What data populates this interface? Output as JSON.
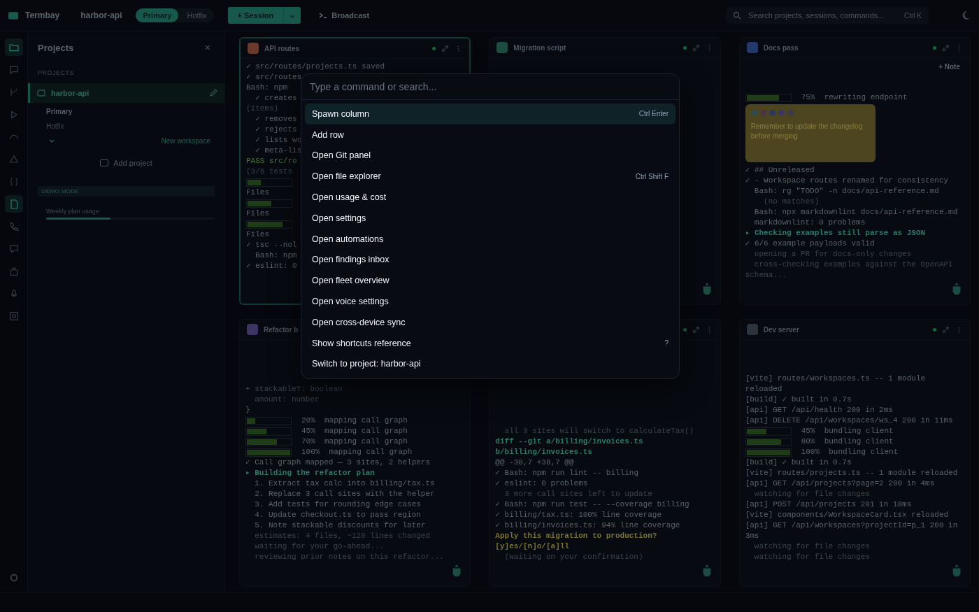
{
  "topbar": {
    "app_name": "Termbay",
    "project": "harbor-api",
    "workspaces": [
      {
        "label": "Primary",
        "selected": true
      },
      {
        "label": "Hotfix",
        "selected": false
      }
    ],
    "session_button": "+ Session",
    "broadcast": "Broadcast",
    "search": {
      "placeholder": "Search projects, sessions, commands...",
      "shortcut": "Ctrl K"
    }
  },
  "rail": [
    {
      "selected": true
    },
    {
      "selected": false
    },
    {
      "selected": false
    },
    {
      "selected": false
    },
    {
      "selected": false
    },
    {
      "selected": false
    },
    {
      "selected": false
    },
    {
      "selected": true
    },
    {
      "selected": false
    },
    {
      "selected": false
    },
    {
      "selected": false
    },
    {
      "selected": false
    },
    {
      "selected": false
    }
  ],
  "sidebar": {
    "title": "Projects",
    "close": "×",
    "section": "PROJECTS",
    "projects": [
      {
        "name": "harbor-api",
        "selected": true,
        "workspaces": [
          {
            "label": "Primary",
            "selected": true
          },
          {
            "label": "Hotfix",
            "selected": false
          }
        ]
      }
    ],
    "new_workspace": "New workspace",
    "add_project": "Add project",
    "demo_banner": "DEMO MODE",
    "usage": {
      "label": "Weekly plan usage",
      "level": 0.38
    }
  },
  "panels": [
    {
      "title": "API routes",
      "color": "#6b3a2a",
      "active": true,
      "controls": true,
      "robot": false,
      "lines": [
        {
          "kind": "ok",
          "text": "✓ src/routes/projects.ts saved"
        },
        {
          "kind": "ok",
          "text": "✓ src/routes"
        },
        {
          "kind": "text",
          "text": "Bash: npm"
        },
        {
          "kind": "ok",
          "text": "  ✓ creates"
        },
        {
          "kind": "dim",
          "text": "(items)"
        },
        {
          "kind": "ok",
          "text": "  ✓ removes"
        },
        {
          "kind": "ok",
          "text": "  ✓ rejects"
        },
        {
          "kind": "ok",
          "text": "  ✓ lists wo"
        },
        {
          "kind": "ok",
          "text": "  ✓ meta-lis"
        },
        {
          "kind": "pass",
          "text": "PASS src/ro"
        },
        {
          "kind": "dim",
          "text": "(3/5 tests"
        },
        {
          "kind": "progress",
          "level": 0.3
        },
        {
          "kind": "text",
          "text": "Files"
        },
        {
          "kind": "progress",
          "level": 0.55
        },
        {
          "kind": "text",
          "text": "Files"
        },
        {
          "kind": "progress",
          "level": 0.8
        },
        {
          "kind": "text",
          "text": "Files"
        },
        {
          "kind": "ok",
          "text": "✓ tsc --nol"
        },
        {
          "kind": "text",
          "text": "  Bash: npm"
        },
        {
          "kind": "ok",
          "text": "✓ eslint: 0"
        }
      ]
    },
    {
      "title": "Migration script",
      "color": "#1d4d3e",
      "active": false,
      "controls": true,
      "robot": true
    },
    {
      "title": "Docs pass",
      "color": "#23386b",
      "active": false,
      "controls": true,
      "robot": true,
      "note_button": "+ Note",
      "note": {
        "text": "Remember to update the changelog before merging",
        "swatches": [
          {
            "color": "#2e4a4a"
          },
          {
            "color": "#4a3446"
          },
          {
            "color": "#2a3a5a"
          },
          {
            "color": "#3d3466"
          },
          {
            "color": "#3a3d48"
          }
        ]
      },
      "lines": [
        {
          "kind": "progress",
          "level": 0.75,
          "text": "75%  rewriting endpoint"
        },
        {
          "kind": "note"
        },
        {
          "kind": "ok",
          "text": "✓ ## Unreleased"
        },
        {
          "kind": "ok",
          "text": "✓ - Workspace routes renamed for consistency"
        },
        {
          "kind": "text",
          "text": "  Bash: rg \"TODO\" -n docs/api-reference.md"
        },
        {
          "kind": "dim",
          "text": "    (no matches)"
        },
        {
          "kind": "text",
          "text": "  Bash: npx markdownlint docs/api-reference.md"
        },
        {
          "kind": "text",
          "text": "  markdownlint: 0 problems"
        },
        {
          "kind": "accent",
          "text": "▸ Checking examples still parse as JSON"
        },
        {
          "kind": "ok",
          "text": "✓ 6/6 example payloads valid"
        },
        {
          "kind": "dim",
          "text": "  opening a PR for docs-only changes"
        },
        {
          "kind": "dim",
          "text": "  cross-checking examples against the OpenAPI schema..."
        }
      ]
    },
    {
      "title": "Refactor b",
      "color": "#3d3466",
      "active": false,
      "controls": false,
      "robot": true,
      "lines": [
        {
          "kind": "dim",
          "text": "+ stackable?: boolean"
        },
        {
          "kind": "dim",
          "text": "  amount: number"
        },
        {
          "kind": "text",
          "text": "}"
        },
        {
          "kind": "progress",
          "level": 0.2,
          "text": "20%  mapping call graph"
        },
        {
          "kind": "progress",
          "level": 0.45,
          "text": "45%  mapping call graph"
        },
        {
          "kind": "progress",
          "level": 0.7,
          "text": "70%  mapping call graph"
        },
        {
          "kind": "progress",
          "level": 1,
          "text": "100%  mapping call graph"
        },
        {
          "kind": "ok",
          "text": "✓ Call graph mapped — 3 sites, 2 helpers"
        },
        {
          "kind": "accent",
          "text": "▸ Building the refactor plan"
        },
        {
          "kind": "text",
          "text": "  1. Extract tax calc into billing/tax.ts"
        },
        {
          "kind": "text",
          "text": "  2. Replace 3 call sites with the helper"
        },
        {
          "kind": "text",
          "text": "  3. Add tests for rounding edge cases"
        },
        {
          "kind": "text",
          "text": "  4. Update checkout.ts to pass region"
        },
        {
          "kind": "text",
          "text": "  5. Note stackable discounts for later"
        },
        {
          "kind": "dim",
          "text": "  estimates: 4 files, ~120 lines changed"
        },
        {
          "kind": "dim",
          "text": "  waiting for your go-ahead..."
        },
        {
          "kind": "dim",
          "text": "  reviewing prior notes on this refactor..."
        }
      ]
    },
    {
      "active": false,
      "controls": true,
      "robot": true,
      "lines": [
        {
          "kind": "dim",
          "text": "  all 3 sites will switch to calculateTax()"
        },
        {
          "kind": "accent",
          "text": "diff --git a/billing/invoices.ts b/billing/invoices.ts"
        },
        {
          "kind": "text",
          "text": "@@ -38,7 +38,7 @@"
        },
        {
          "kind": "ok",
          "text": "✓ Bash: npm run lint -- billing"
        },
        {
          "kind": "ok",
          "text": "✓ eslint: 0 problems"
        },
        {
          "kind": "dim",
          "text": "  3 more call sites left to update"
        },
        {
          "kind": "ok",
          "text": "✓ Bash: npm run test -- --coverage billing"
        },
        {
          "kind": "ok",
          "text": "✓ billing/tax.ts: 100% line coverage"
        },
        {
          "kind": "ok",
          "text": "✓ billing/invoices.ts: 94% line coverage"
        },
        {
          "kind": "warn",
          "text": "Apply this migration to production? [y]es/[n]o/[a]ll"
        },
        {
          "kind": "dim",
          "text": "  (waiting on your confirmation)"
        }
      ]
    },
    {
      "title": "Dev server",
      "color": "#2c333d",
      "active": false,
      "controls": true,
      "robot": true,
      "lines": [
        {
          "kind": "text",
          "text": "[vite] routes/workspaces.ts -- 1 module reloaded"
        },
        {
          "kind": "ok",
          "text": "[build] ✓ built in 0.7s"
        },
        {
          "kind": "text",
          "text": "[api] GET /api/health 200 in 2ms"
        },
        {
          "kind": "text",
          "text": "[api] DELETE /api/workspaces/ws_4 200 in 11ms"
        },
        {
          "kind": "progress",
          "level": 0.45,
          "text": "45%  bundling client"
        },
        {
          "kind": "progress",
          "level": 0.8,
          "text": "80%  bundling client"
        },
        {
          "kind": "progress",
          "level": 1,
          "text": "100%  bundling client"
        },
        {
          "kind": "ok",
          "text": "[build] ✓ built in 0.7s"
        },
        {
          "kind": "text",
          "text": "[vite] routes/projects.ts -- 1 module reloaded"
        },
        {
          "kind": "text",
          "text": "[api] GET /api/projects?page=2 200 in 4ms"
        },
        {
          "kind": "dim",
          "text": "  watching for file changes"
        },
        {
          "kind": "text",
          "text": "[api] POST /api/projects 201 in 18ms"
        },
        {
          "kind": "text",
          "text": "[vite] components/WorkspaceCard.tsx reloaded"
        },
        {
          "kind": "text",
          "text": "[api] GET /api/workspaces?projectId=p_1 200 in 3ms"
        },
        {
          "kind": "dim",
          "text": "  watching for file changes"
        },
        {
          "kind": "dim",
          "text": "  watching for file changes"
        }
      ]
    }
  ],
  "palette": {
    "placeholder": "Type a command or search...",
    "commands": [
      {
        "label": "Spawn column",
        "shortcut": "Ctrl Enter",
        "selected": true
      },
      {
        "label": "Add row",
        "selected": false
      },
      {
        "label": "Open Git panel",
        "selected": false
      },
      {
        "label": "Open file explorer",
        "shortcut": "Ctrl Shift F",
        "selected": false
      },
      {
        "label": "Open usage & cost",
        "selected": false
      },
      {
        "label": "Open settings",
        "selected": false
      },
      {
        "label": "Open automations",
        "selected": false
      },
      {
        "label": "Open findings inbox",
        "selected": false
      },
      {
        "label": "Open fleet overview",
        "selected": false
      },
      {
        "label": "Open voice settings",
        "selected": false
      },
      {
        "label": "Open cross-device sync",
        "selected": false
      },
      {
        "label": "Show shortcuts reference",
        "shortcut": "?",
        "selected": false
      },
      {
        "label": "Switch to project: harbor-api",
        "selected": false
      }
    ]
  }
}
